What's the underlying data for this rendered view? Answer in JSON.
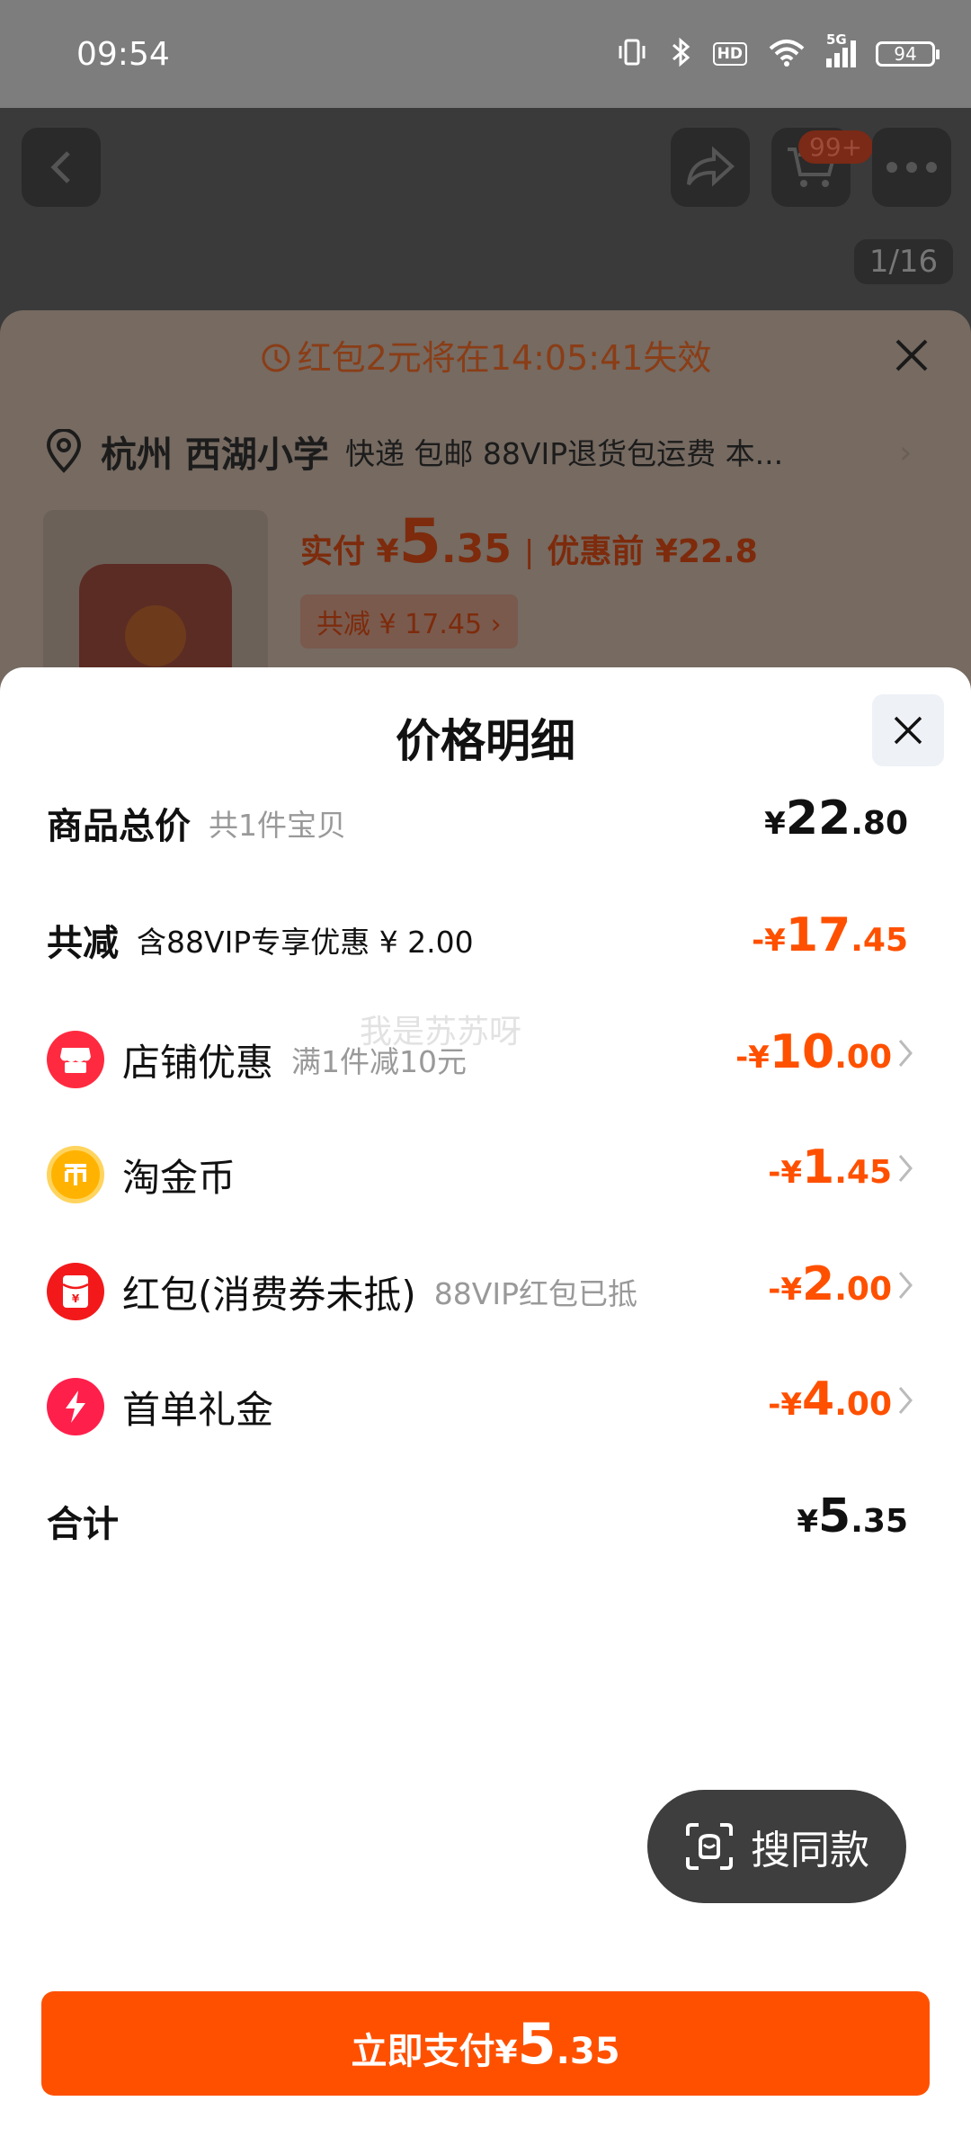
{
  "status_bar": {
    "time": "09:54",
    "hd": "HD",
    "net": "5G",
    "battery": "94"
  },
  "background": {
    "cart_badge": "99+",
    "image_pager": "1/16",
    "order": {
      "timer_text": "红包2元将在14:05:41失效",
      "city": "杭州 西湖小学",
      "delivery_note": "快递 包邮 88VIP退货包运费 本...",
      "pay_label": "实付 ¥ ",
      "pay_int": "5",
      "pay_dec": ".35",
      "sep": "|",
      "original_price": "优惠前 ¥22.8",
      "total_saving": "共减 ¥ 17.45 ›"
    }
  },
  "panel": {
    "title": "价格明细",
    "rows": {
      "subtotal": {
        "label": "商品总价",
        "sub": "共1件宝贝",
        "sym": "¥",
        "int": "22",
        "dec": ".80"
      },
      "discount": {
        "label": "共减",
        "sub": "含88VIP专享优惠 ¥ 2.00",
        "sym": "-¥",
        "int": "17",
        "dec": ".45"
      },
      "shop": {
        "label": "店铺优惠",
        "sub": "满1件减10元",
        "sym": "-¥",
        "int": "10",
        "dec": ".00"
      },
      "coins": {
        "label": "淘金币",
        "sub": "",
        "sym": "-¥",
        "int": "1",
        "dec": ".45"
      },
      "redpacket": {
        "label": "红包(消费券未抵)",
        "sub": "88VIP红包已抵",
        "sym": "-¥",
        "int": "2",
        "dec": ".00"
      },
      "firstorder": {
        "label": "首单礼金",
        "sub": "",
        "sym": "-¥",
        "int": "4",
        "dec": ".00"
      },
      "total": {
        "label": "合计",
        "sym": "¥",
        "int": "5",
        "dec": ".35"
      }
    },
    "watermark": "我是苏苏呀",
    "search_same_label": "搜同款",
    "pay_button": {
      "label": "立即支付 ",
      "sym": "¥",
      "int": "5",
      "dec": ".35"
    }
  },
  "colors": {
    "accent": "#ff5000",
    "text": "#111111",
    "muted": "#999999",
    "button": "#ff5000"
  }
}
